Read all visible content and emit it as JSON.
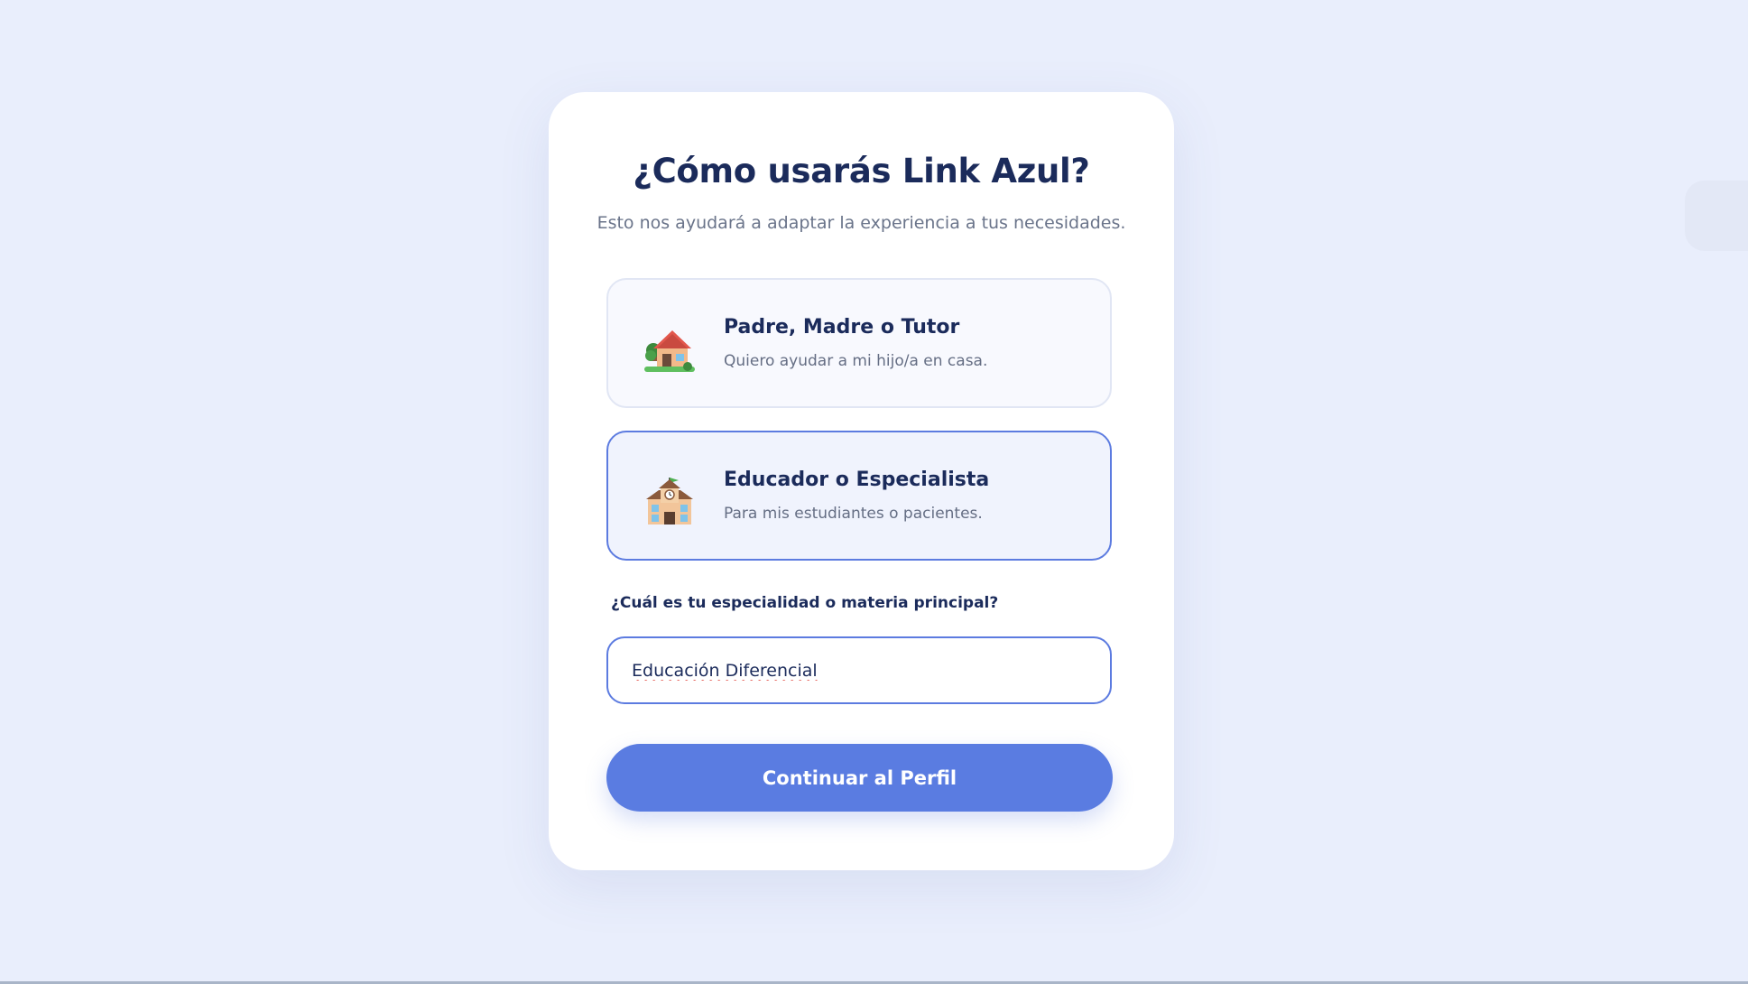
{
  "header": {
    "title": "¿Cómo usarás Link Azul?",
    "subtitle": "Esto nos ayudará a adaptar la experiencia a tus necesidades."
  },
  "options": [
    {
      "icon": "house-icon",
      "title": "Padre, Madre o Tutor",
      "description": "Quiero ayudar a mi hijo/a en casa.",
      "selected": false
    },
    {
      "icon": "school-icon",
      "title": "Educador o Especialista",
      "description": "Para mis estudiantes o pacientes.",
      "selected": true
    }
  ],
  "specialty": {
    "label": "¿Cuál es tu especialidad o materia principal?",
    "value": "Educación Diferencial"
  },
  "actions": {
    "continue_label": "Continuar al Perfil"
  },
  "colors": {
    "background": "#e9eefc",
    "accent": "#5a7ce1",
    "heading": "#1b2b5b"
  }
}
